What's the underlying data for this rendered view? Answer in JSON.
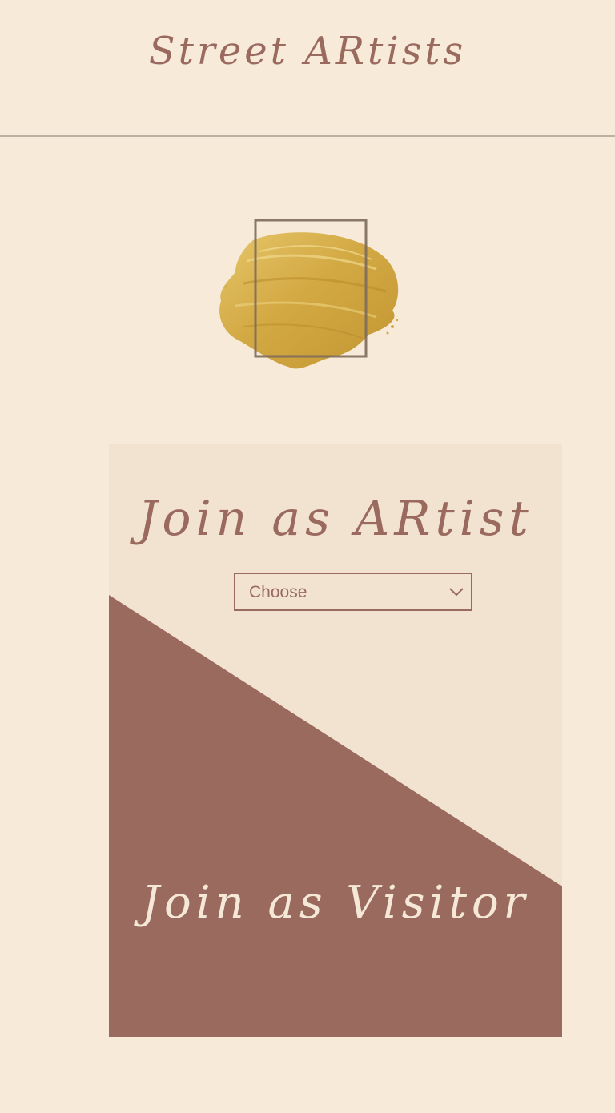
{
  "header": {
    "title": "Street ARtists"
  },
  "logo": {
    "icon": "gold-paint-brush-stroke-logo"
  },
  "card": {
    "artist": {
      "title": "Join as ARtist",
      "select": {
        "selected": "Choose"
      }
    },
    "visitor": {
      "title": "Join as Visitor"
    }
  },
  "colors": {
    "background": "#f7ead8",
    "card_background": "#f2e3d0",
    "accent": "#9b6a5f",
    "visitor_text": "#f5e8d6",
    "gold": "#d4aa44",
    "header_border": "#bdb0a3"
  }
}
